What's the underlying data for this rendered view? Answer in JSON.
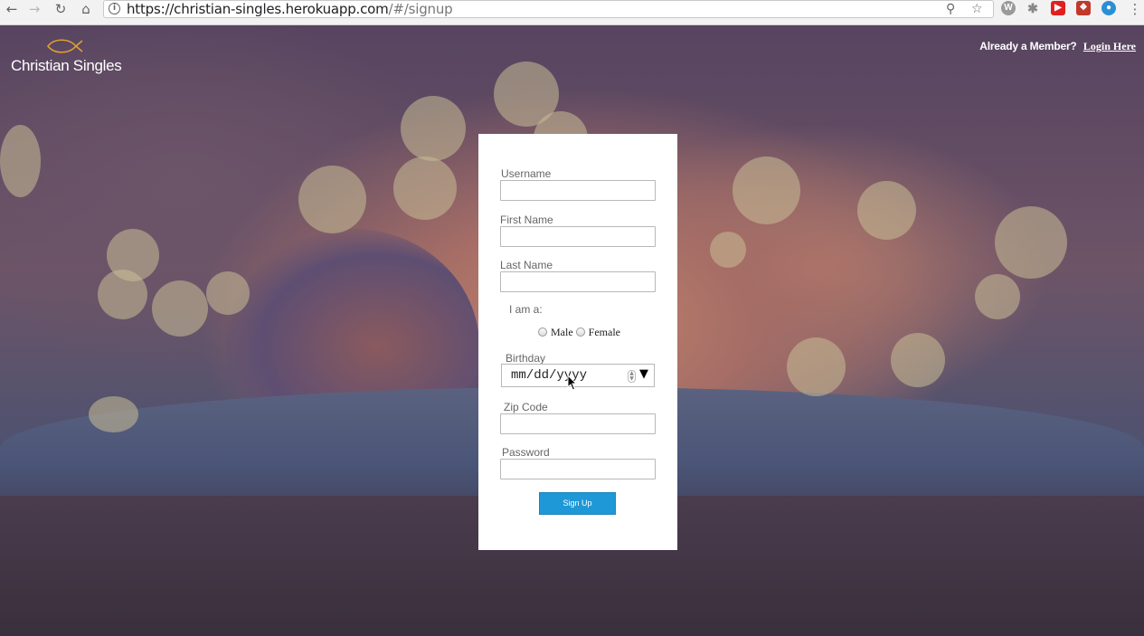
{
  "browser": {
    "url_host": "https://christian-singles.herokuapp.com",
    "url_path": "/#/signup",
    "nav_icons": [
      "back-icon",
      "forward-icon",
      "reload-icon",
      "home-icon"
    ],
    "extensions": [
      "w-extension-icon",
      "puzzle-extension-icon",
      "youtube-extension-icon",
      "red-extension-icon",
      "blue-extension-icon"
    ]
  },
  "header": {
    "brand": "Christian Singles",
    "member_prompt": "Already a Member?",
    "login_link": "Login Here"
  },
  "form": {
    "username_label": "Username",
    "first_name_label": "First Name",
    "last_name_label": "Last Name",
    "gender_label": "I am a:",
    "gender_male": "Male",
    "gender_female": "Female",
    "birthday_label": "Birthday",
    "birthday_placeholder": "mm/dd/yyyy",
    "zip_label": "Zip Code",
    "password_label": "Password",
    "submit_label": "Sign Up"
  },
  "colors": {
    "accent": "#1e98d6",
    "fish": "#e0a030"
  }
}
